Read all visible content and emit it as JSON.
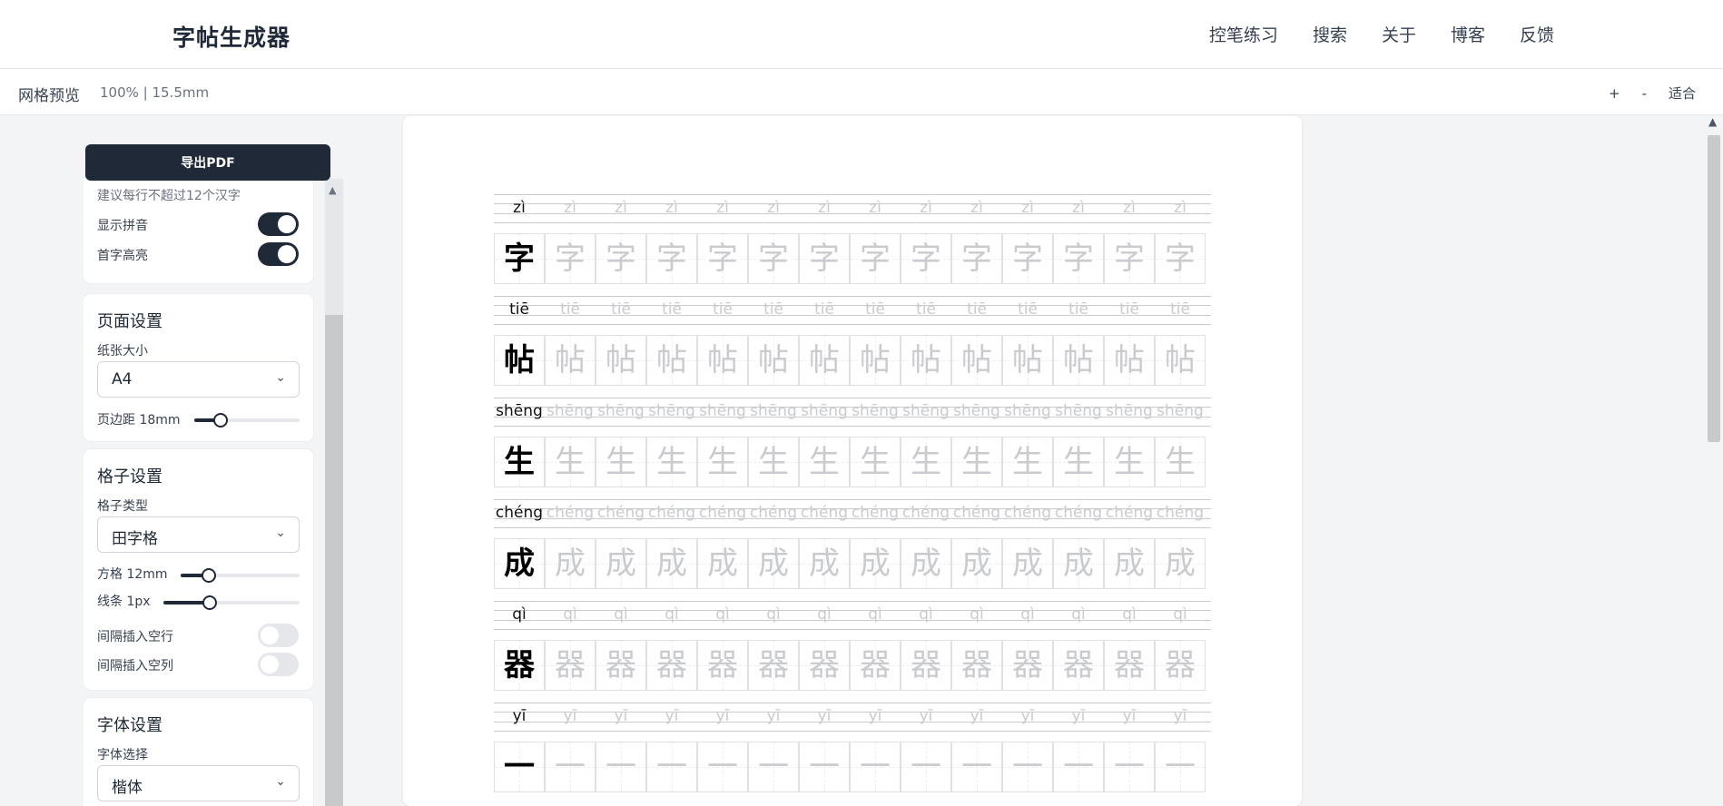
{
  "app": {
    "title": "字帖生成器",
    "nav": [
      "控笔练习",
      "搜索",
      "关于",
      "博客",
      "反馈"
    ]
  },
  "toolbar": {
    "title": "网格预览",
    "zoom": "100% | 15.5mm",
    "zoom_in": "+",
    "zoom_out": "-",
    "fit": "适合"
  },
  "sidebar": {
    "export_label": "导出PDF",
    "text_card": {
      "hint": "建议每行不超过12个汉字",
      "show_pinyin_label": "显示拼音",
      "show_pinyin": true,
      "highlight_first_label": "首字高亮",
      "highlight_first": true
    },
    "page_card": {
      "title": "页面设置",
      "paper_label": "纸张大小",
      "paper_value": "A4",
      "margin_label": "页边距 18mm",
      "margin_level": 0.25
    },
    "grid_card": {
      "title": "格子设置",
      "type_label": "格子类型",
      "type_value": "田字格",
      "size_label": "方格 12mm",
      "size_level": 0.25,
      "line_label": "线条 1px",
      "line_level": 0.35,
      "blank_row_label": "间隔插入空行",
      "blank_row": false,
      "blank_col_label": "间隔插入空列",
      "blank_col": false
    },
    "font_card": {
      "title": "字体设置",
      "font_label": "字体选择",
      "font_value": "楷体"
    }
  },
  "sheet": {
    "columns": 14,
    "rows": [
      {
        "char": "字",
        "pinyin": "zì"
      },
      {
        "char": "帖",
        "pinyin": "tiē"
      },
      {
        "char": "生",
        "pinyin": "shēng"
      },
      {
        "char": "成",
        "pinyin": "chéng"
      },
      {
        "char": "器",
        "pinyin": "qì"
      },
      {
        "char": "一",
        "pinyin": "yī"
      }
    ]
  },
  "colors": {
    "primary": "#1f2937",
    "ghost": "#c9cbcf",
    "grid": "#dfe1e5"
  }
}
